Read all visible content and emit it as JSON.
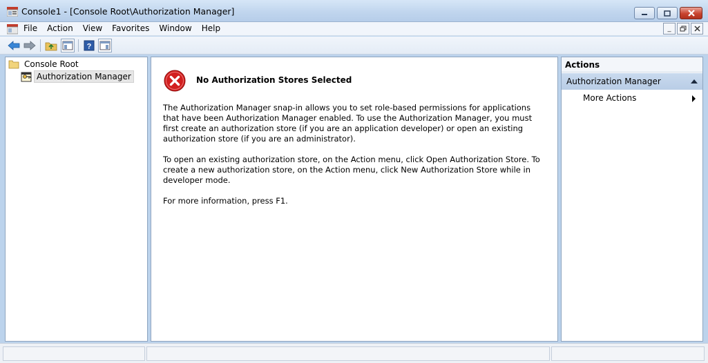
{
  "window": {
    "title": "Console1 - [Console Root\\Authorization Manager]",
    "icon": "mmc-console-icon"
  },
  "menu": {
    "items": [
      "File",
      "Action",
      "View",
      "Favorites",
      "Window",
      "Help"
    ]
  },
  "toolbar": {
    "buttons": [
      "back-arrow-icon",
      "forward-arrow-icon",
      "up-folder-icon",
      "show-hide-tree-icon",
      "help-icon",
      "show-hide-action-pane-icon"
    ]
  },
  "tree": {
    "root": "Console Root",
    "child": "Authorization Manager"
  },
  "main": {
    "title": "No Authorization Stores Selected",
    "para1": "The Authorization Manager snap-in allows you to set role-based permissions for applications that have been Authorization Manager enabled. To use the Authorization Manager, you must first create an authorization store (if you are an application developer) or open an existing authorization store (if you are an administrator).",
    "para2": "To open an existing authorization store, on the Action menu, click Open Authorization Store. To create a new authorization store, on the Action menu, click New Authorization Store while in developer mode.",
    "para3": "For more information, press F1."
  },
  "actions": {
    "header": "Actions",
    "section": "Authorization Manager",
    "item": "More Actions"
  },
  "colors": {
    "error_red": "#d21f1f",
    "section_blue": "#c0d4eb"
  }
}
